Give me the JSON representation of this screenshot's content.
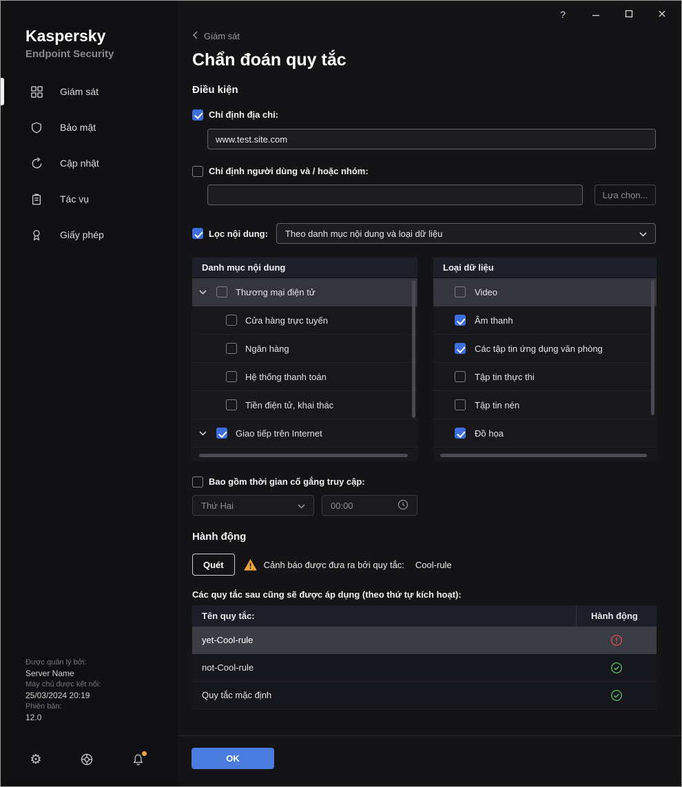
{
  "window": {
    "help_label": "?"
  },
  "brand": {
    "name": "Kaspersky",
    "subtitle": "Endpoint Security"
  },
  "sidebar": {
    "items": [
      {
        "label": "Giám sát",
        "active": true
      },
      {
        "label": "Bảo mật",
        "active": false
      },
      {
        "label": "Cập nhật",
        "active": false
      },
      {
        "label": "Tác vụ",
        "active": false
      },
      {
        "label": "Giấy phép",
        "active": false
      }
    ],
    "footer": {
      "managed_by_label": "Được quản lý bởi:",
      "managed_by_value": "Server Name",
      "connected_label": "Máy chủ được kết nối:",
      "connected_value": "25/03/2024 20:19",
      "version_label": "Phiên bản:",
      "version_value": "12.0"
    }
  },
  "icons": {
    "gear": "⚙"
  },
  "page": {
    "back_label": "Giám sát",
    "title": "Chẩn đoán quy tắc",
    "conditions_heading": "Điều kiện",
    "address": {
      "label": "Chỉ định địa chỉ:",
      "checked": true,
      "value": "www.test.site.com"
    },
    "users": {
      "label": "Chỉ định người dùng và / hoặc nhóm:",
      "checked": false,
      "value": "",
      "choose_button": "Lựa chọn..."
    },
    "content_filter": {
      "label": "Lọc nội dung:",
      "checked": true,
      "selected_option": "Theo danh mục nội dung và loại dữ liệu"
    },
    "categories_panel": {
      "header": "Danh mục nội dung",
      "items": [
        {
          "label": "Thương mại điện tử",
          "checked": false,
          "expandable": true,
          "level": 0,
          "highlighted": true
        },
        {
          "label": "Cửa hàng trực tuyến",
          "checked": false,
          "expandable": false,
          "level": 1,
          "highlighted": false
        },
        {
          "label": "Ngân hàng",
          "checked": false,
          "expandable": false,
          "level": 1,
          "highlighted": false
        },
        {
          "label": "Hệ thống thanh toán",
          "checked": false,
          "expandable": false,
          "level": 1,
          "highlighted": false
        },
        {
          "label": "Tiền điện tử, khai thác",
          "checked": false,
          "expandable": false,
          "level": 1,
          "highlighted": false
        },
        {
          "label": "Giao tiếp trên Internet",
          "checked": true,
          "expandable": true,
          "level": 0,
          "highlighted": false
        }
      ]
    },
    "datatypes_panel": {
      "header": "Loại dữ liệu",
      "items": [
        {
          "label": "Video",
          "checked": false,
          "highlighted": true
        },
        {
          "label": "Âm thanh",
          "checked": true,
          "highlighted": false
        },
        {
          "label": "Các tập tin ứng dụng văn phòng",
          "checked": true,
          "highlighted": false
        },
        {
          "label": "Tập tin thực thi",
          "checked": false,
          "highlighted": false
        },
        {
          "label": "Tập tin nén",
          "checked": false,
          "highlighted": false
        },
        {
          "label": "Đồ họa",
          "checked": true,
          "highlighted": false
        }
      ]
    },
    "time_filter": {
      "label": "Bao gồm thời gian cố gắng truy cập:",
      "checked": false,
      "day_value": "Thứ Hai",
      "time_value": "00:00"
    },
    "action_heading": "Hành động",
    "action_button": "Quét",
    "warning_text": "Cảnh báo được đưa ra bởi quy tắc:",
    "warning_rule": "Cool-rule",
    "rules_caption": "Các quy tắc sau cũng sẽ được áp dụng (theo thứ tự kích hoạt):",
    "rules_table": {
      "col_name": "Tên quy tắc:",
      "col_action": "Hành động",
      "rows": [
        {
          "name": "yet-Cool-rule",
          "status": "warning",
          "selected": true
        },
        {
          "name": "not-Cool-rule",
          "status": "ok",
          "selected": false
        },
        {
          "name": "Quy tắc mặc định",
          "status": "ok",
          "selected": false
        }
      ]
    },
    "ok_button": "OK"
  },
  "colors": {
    "accent_blue": "#3d6edb",
    "ok_button_blue": "#4a7ce0",
    "warning_orange": "#eda33c",
    "error_red": "#d05050",
    "success_green": "#58b368"
  }
}
